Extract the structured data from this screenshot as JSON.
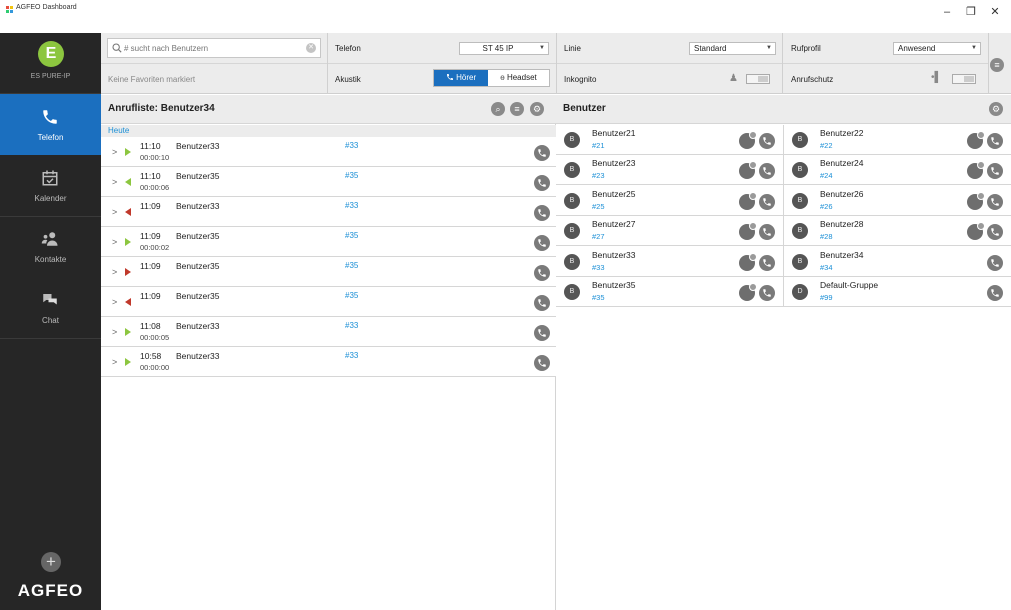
{
  "window": {
    "title": "AGFEO Dashboard",
    "controls": [
      "–",
      "❐",
      "✕"
    ],
    "app_icon_colors": [
      "#e74c3c",
      "#f1c40f",
      "#2ecc71",
      "#3498db"
    ]
  },
  "sidebar": {
    "logo_letter": "E",
    "device_name": "ES PURE-IP",
    "items": [
      {
        "label": "Telefon",
        "icon": "phone-icon",
        "active": true
      },
      {
        "label": "Kalender",
        "icon": "calendar-icon",
        "active": false
      },
      {
        "label": "Kontakte",
        "icon": "contacts-icon",
        "active": false
      },
      {
        "label": "Chat",
        "icon": "chat-icon",
        "active": false
      }
    ],
    "add_symbol": "+",
    "brand": "AGFEO"
  },
  "toolbar": {
    "search": {
      "placeholder": "# sucht nach Benutzern",
      "value": ""
    },
    "favorites_text": "Keine Favoriten markiert",
    "telefon_label": "Telefon",
    "telefon_value": "ST 45 IP",
    "akustik_label": "Akustik",
    "akustik_active": "Hörer",
    "akustik_other": "Headset",
    "linie_label": "Linie",
    "linie_value": "Standard",
    "inkognito_label": "Inkognito",
    "rufprofil_label": "Rufprofil",
    "rufprofil_value": "Anwesend",
    "anrufschutz_label": "Anrufschutz"
  },
  "calls": {
    "title": "Anrufliste: Benutzer34",
    "group": "Heute",
    "rows": [
      {
        "dir": "out",
        "time": "11:10",
        "name": "Benutzer33",
        "duration": "00:00:10",
        "number": "#33"
      },
      {
        "dir": "in",
        "time": "11:10",
        "name": "Benutzer35",
        "duration": "00:00:06",
        "number": "#35"
      },
      {
        "dir": "miss-in",
        "time": "11:09",
        "name": "Benutzer33",
        "duration": "",
        "number": "#33"
      },
      {
        "dir": "out",
        "time": "11:09",
        "name": "Benutzer35",
        "duration": "00:00:02",
        "number": "#35"
      },
      {
        "dir": "miss-out",
        "time": "11:09",
        "name": "Benutzer35",
        "duration": "",
        "number": "#35"
      },
      {
        "dir": "miss-in",
        "time": "11:09",
        "name": "Benutzer35",
        "duration": "",
        "number": "#35"
      },
      {
        "dir": "out",
        "time": "11:08",
        "name": "Benutzer33",
        "duration": "00:00:05",
        "number": "#33"
      },
      {
        "dir": "out",
        "time": "10:58",
        "name": "Benutzer33",
        "duration": "00:00:00",
        "number": "#33"
      }
    ]
  },
  "users": {
    "title": "Benutzer",
    "list": [
      {
        "initial": "B",
        "name": "Benutzer21",
        "ext": "#21",
        "chat": true
      },
      {
        "initial": "B",
        "name": "Benutzer22",
        "ext": "#22",
        "chat": true
      },
      {
        "initial": "B",
        "name": "Benutzer23",
        "ext": "#23",
        "chat": true
      },
      {
        "initial": "B",
        "name": "Benutzer24",
        "ext": "#24",
        "chat": true
      },
      {
        "initial": "B",
        "name": "Benutzer25",
        "ext": "#25",
        "chat": true
      },
      {
        "initial": "B",
        "name": "Benutzer26",
        "ext": "#26",
        "chat": true
      },
      {
        "initial": "B",
        "name": "Benutzer27",
        "ext": "#27",
        "chat": true
      },
      {
        "initial": "B",
        "name": "Benutzer28",
        "ext": "#28",
        "chat": true
      },
      {
        "initial": "B",
        "name": "Benutzer33",
        "ext": "#33",
        "chat": true
      },
      {
        "initial": "B",
        "name": "Benutzer34",
        "ext": "#34",
        "chat": false
      },
      {
        "initial": "B",
        "name": "Benutzer35",
        "ext": "#35",
        "chat": true
      },
      {
        "initial": "D",
        "name": "Default-Gruppe",
        "ext": "#99",
        "chat": false
      }
    ]
  },
  "colors": {
    "accent": "#1b6fbf",
    "link": "#1b8fd6",
    "green": "#8cc63f",
    "missed": "#c0392b",
    "sidebar": "#262626"
  }
}
